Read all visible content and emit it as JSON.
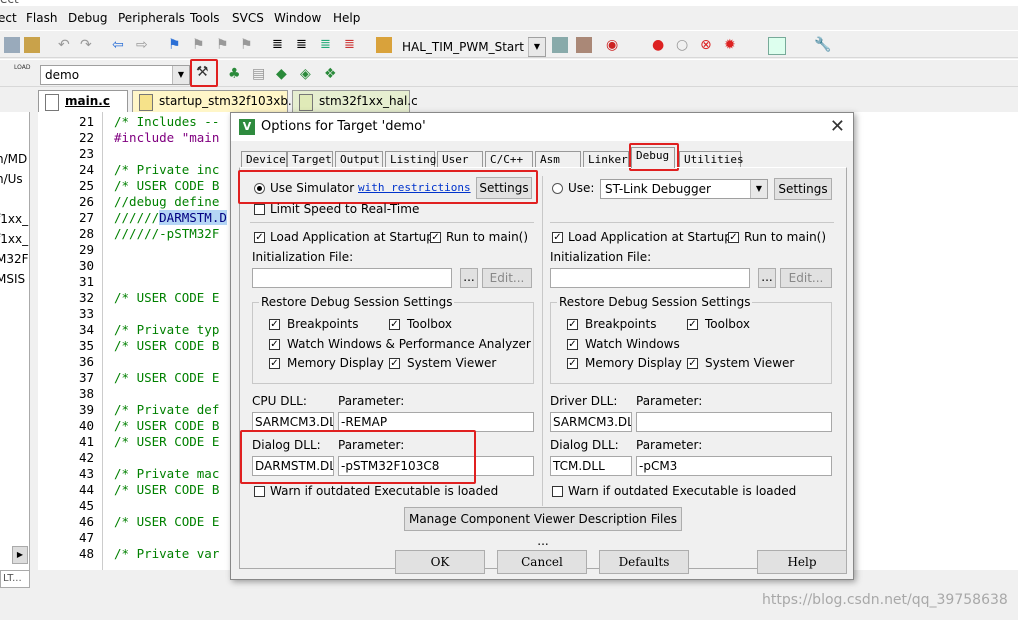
{
  "window": {
    "title_fragment": "ect"
  },
  "menu": [
    "Flash",
    "Debug",
    "Peripherals",
    "Tools",
    "SVCS",
    "Window",
    "Help"
  ],
  "toolbar1": {
    "target_combo": "HAL_TIM_PWM_Start"
  },
  "toolbar2": {
    "target_select": "demo",
    "load_label": "LOAD"
  },
  "file_tabs": [
    "main.c",
    "startup_stm32f103xb.s",
    "stm32f1xx_hal.c"
  ],
  "project_tree": [
    "n/MD",
    "n/Us",
    "f1xx_i",
    "f1xx_l",
    "M32F",
    "MSIS"
  ],
  "editor": {
    "lines": [
      {
        "n": "21",
        "t": "/* Includes --"
      },
      {
        "n": "22",
        "t": "#include \"main"
      },
      {
        "n": "23",
        "t": ""
      },
      {
        "n": "24",
        "t": "/* Private inc"
      },
      {
        "n": "25",
        "t": "/* USER CODE B"
      },
      {
        "n": "26",
        "t": "//debug define"
      },
      {
        "n": "27",
        "t": "//////",
        "hl": "DARMSTM.D"
      },
      {
        "n": "28",
        "t": "//////-pSTM32F"
      },
      {
        "n": "29",
        "t": ""
      },
      {
        "n": "30",
        "t": ""
      },
      {
        "n": "31",
        "t": ""
      },
      {
        "n": "32",
        "t": "/* USER CODE E"
      },
      {
        "n": "33",
        "t": ""
      },
      {
        "n": "34",
        "t": "/* Private typ"
      },
      {
        "n": "35",
        "t": "/* USER CODE B"
      },
      {
        "n": "36",
        "t": ""
      },
      {
        "n": "37",
        "t": "/* USER CODE E"
      },
      {
        "n": "38",
        "t": ""
      },
      {
        "n": "39",
        "t": "/* Private def"
      },
      {
        "n": "40",
        "t": "/* USER CODE B"
      },
      {
        "n": "41",
        "t": "/* USER CODE E"
      },
      {
        "n": "42",
        "t": ""
      },
      {
        "n": "43",
        "t": "/* Private mac"
      },
      {
        "n": "44",
        "t": "/* USER CODE B"
      },
      {
        "n": "45",
        "t": ""
      },
      {
        "n": "46",
        "t": "/* USER CODE E"
      },
      {
        "n": "47",
        "t": ""
      },
      {
        "n": "48",
        "t": "/* Private var"
      }
    ]
  },
  "dialog": {
    "title": "Options for Target 'demo'",
    "icon_letter": "V",
    "tabs": [
      "Device",
      "Target",
      "Output",
      "Listing",
      "User",
      "C/C++",
      "Asm",
      "Linker",
      "Debug",
      "Utilities"
    ],
    "active_tab": "Debug",
    "left": {
      "use_simulator": "Use Simulator",
      "with_restrictions": "with restrictions",
      "settings": "Settings",
      "limit_speed": "Limit Speed to Real-Time",
      "load_app": "Load Application at Startup",
      "run_to_main": "Run to main()",
      "init_file": "Initialization File:",
      "browse": "...",
      "edit": "Edit...",
      "restore_group": "Restore Debug Session Settings",
      "breakpoints": "Breakpoints",
      "toolbox": "Toolbox",
      "watch": "Watch Windows & Performance Analyzer",
      "memory": "Memory Display",
      "sysviewer": "System Viewer",
      "cpu_dll_label": "CPU DLL:",
      "param_label": "Parameter:",
      "cpu_dll": "SARMCM3.DLL",
      "cpu_param": "-REMAP",
      "dialog_dll_label": "Dialog DLL:",
      "dialog_dll": "DARMSTM.DLL",
      "dialog_param": "-pSTM32F103C8",
      "warn": "Warn if outdated Executable is loaded"
    },
    "right": {
      "use": "Use:",
      "debugger": "ST-Link Debugger",
      "settings": "Settings",
      "load_app": "Load Application at Startup",
      "run_to_main": "Run to main()",
      "init_file": "Initialization File:",
      "browse": "...",
      "edit": "Edit...",
      "restore_group": "Restore Debug Session Settings",
      "breakpoints": "Breakpoints",
      "toolbox": "Toolbox",
      "watch": "Watch Windows",
      "memory": "Memory Display",
      "sysviewer": "System Viewer",
      "driver_dll_label": "Driver DLL:",
      "param_label": "Parameter:",
      "driver_dll": "SARMCM3.DLL",
      "driver_param": "",
      "dialog_dll_label": "Dialog DLL:",
      "dialog_dll": "TCM.DLL",
      "dialog_param": "-pCM3",
      "warn": "Warn if outdated Executable is loaded"
    },
    "manage_btn": "Manage Component Viewer Description Files ...",
    "ok": "OK",
    "cancel": "Cancel",
    "defaults": "Defaults",
    "help": "Help"
  },
  "watermark": "https://blog.csdn.net/qq_39758638",
  "status_left": "LT..."
}
